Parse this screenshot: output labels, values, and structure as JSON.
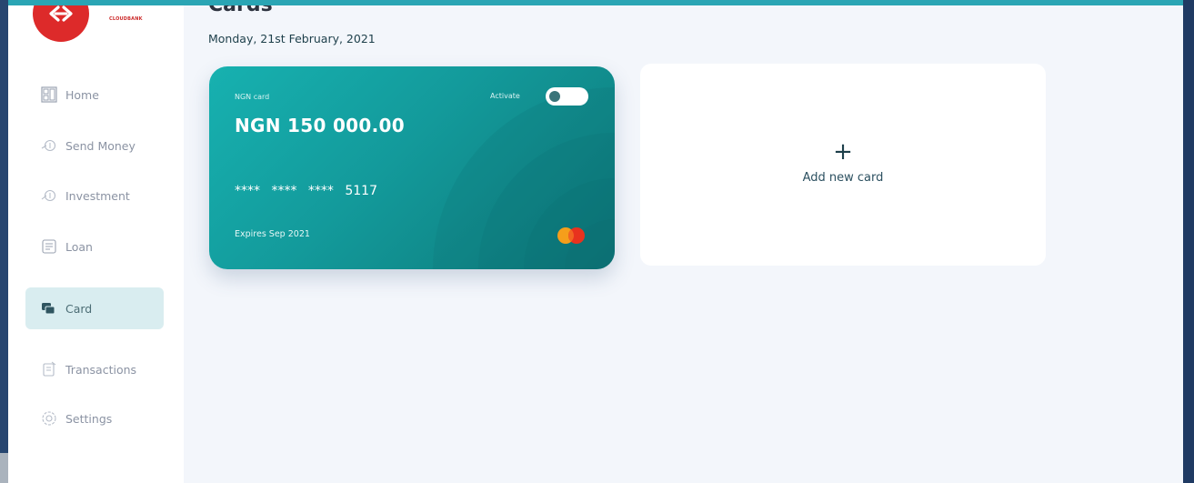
{
  "brand": {
    "logo_text": "CLOUDBANK"
  },
  "sidebar": {
    "items": [
      {
        "label": "Home",
        "icon": "home-icon"
      },
      {
        "label": "Send Money",
        "icon": "send-money-icon"
      },
      {
        "label": "Investment",
        "icon": "investment-icon"
      },
      {
        "label": "Loan",
        "icon": "loan-icon"
      },
      {
        "label": "Card",
        "icon": "card-icon",
        "active": true
      },
      {
        "label": "Transactions",
        "icon": "transactions-icon"
      },
      {
        "label": "Settings",
        "icon": "settings-icon"
      }
    ]
  },
  "header": {
    "title": "Cards",
    "date": "Monday, 21st February, 2021"
  },
  "card": {
    "label": "NGN card",
    "activate_label": "Activate",
    "balance": "NGN 150 000.00",
    "number": "**** **** **** 5117",
    "expiry": "Expires Sep 2021",
    "network_icon": "mastercard-icon"
  },
  "add_card": {
    "plus": "+",
    "label": "Add new card"
  },
  "colors": {
    "accent_teal": "#139a9b",
    "logo_red": "#dd2a2a",
    "frame_top": "#2aa5b4",
    "background": "#f3f6fb"
  }
}
